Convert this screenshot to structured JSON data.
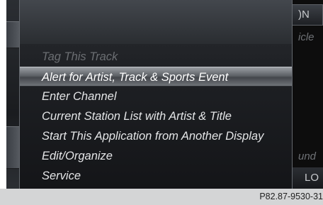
{
  "menu": {
    "items": [
      {
        "label": "Tag This Track",
        "state": "disabled"
      },
      {
        "label": "Alert for Artist, Track & Sports Event",
        "state": "selected"
      },
      {
        "label": "Enter Channel",
        "state": "normal"
      },
      {
        "label": "Current Station List with Artist & Title",
        "state": "normal"
      },
      {
        "label": "Start This Application from Another Display",
        "state": "normal"
      },
      {
        "label": "Edit/Organize",
        "state": "normal"
      },
      {
        "label": "Service",
        "state": "normal"
      }
    ]
  },
  "background_right": {
    "top_label": ")N",
    "second_label": "icle",
    "sound_label": "und",
    "bottom_label": "LO"
  },
  "caption": "P82.87-9530-31"
}
